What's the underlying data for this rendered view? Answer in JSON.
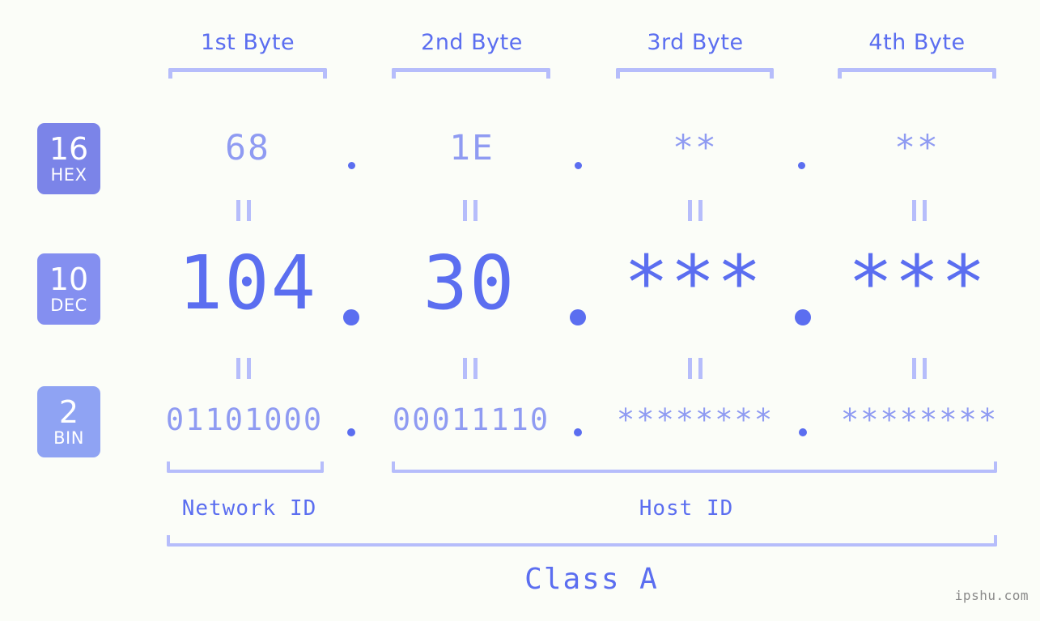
{
  "page": {
    "background": "#fbfdf8",
    "accent": "#5b6ef0",
    "accent_light": "#8f9bf2",
    "bracket": "#b6bdfb",
    "watermark": "ipshu.com"
  },
  "byte_headers": [
    {
      "label": "1st Byte"
    },
    {
      "label": "2nd Byte"
    },
    {
      "label": "3rd Byte"
    },
    {
      "label": "4th Byte"
    }
  ],
  "bases": [
    {
      "num": "16",
      "name": "HEX",
      "color": "#7b84e8"
    },
    {
      "num": "10",
      "name": "DEC",
      "color": "#848ff0"
    },
    {
      "num": "2",
      "name": "BIN",
      "color": "#8fa3f3"
    }
  ],
  "rows": {
    "hex": {
      "values": [
        "68",
        "1E",
        "**",
        "**"
      ]
    },
    "dec": {
      "values": [
        "104",
        "30",
        "***",
        "***"
      ]
    },
    "bin": {
      "values": [
        "01101000",
        "00011110",
        "********",
        "********"
      ]
    }
  },
  "separators": {
    "hex": [
      ".",
      ".",
      "."
    ],
    "dec": [
      ".",
      ".",
      "."
    ],
    "bin": [
      ".",
      ".",
      "."
    ]
  },
  "equals": {
    "glyph": "=",
    "count_per_row": 4
  },
  "regions": [
    {
      "label": "Network ID"
    },
    {
      "label": "Host ID"
    }
  ],
  "class": {
    "label": "Class A"
  }
}
